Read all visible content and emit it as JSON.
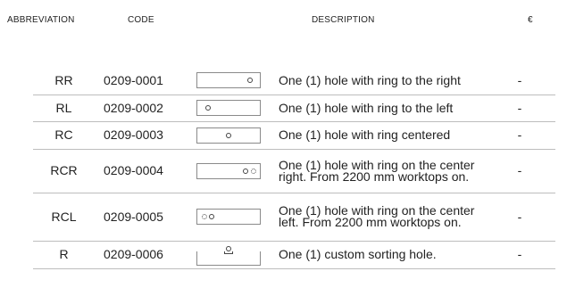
{
  "header": {
    "abbreviation": "ABBREVIATION",
    "code": "CODE",
    "description": "DESCRIPTION",
    "price": "€"
  },
  "rows": [
    {
      "abbr": "RR",
      "code": "0209-0001",
      "desc": "One (1) hole with ring to the right",
      "price": "-",
      "icon": "ring-right-icon"
    },
    {
      "abbr": "RL",
      "code": "0209-0002",
      "desc": "One (1) hole with ring to the left",
      "price": "-",
      "icon": "ring-left-icon"
    },
    {
      "abbr": "RC",
      "code": "0209-0003",
      "desc": "One (1) hole with ring centered",
      "price": "-",
      "icon": "ring-center-icon"
    },
    {
      "abbr": "RCR",
      "code": "0209-0004",
      "desc": "One (1) hole with ring on the center right. From 2200 mm worktops on.",
      "price": "-",
      "icon": "ring-center-right-icon"
    },
    {
      "abbr": "RCL",
      "code": "0209-0005",
      "desc": "One (1) hole with ring on the center left. From 2200 mm worktops on.",
      "price": "-",
      "icon": "ring-center-left-icon"
    },
    {
      "abbr": "R",
      "code": "0209-0006",
      "desc": "One (1) custom sorting hole.",
      "price": "-",
      "icon": "custom-sorting-hole-icon"
    }
  ]
}
